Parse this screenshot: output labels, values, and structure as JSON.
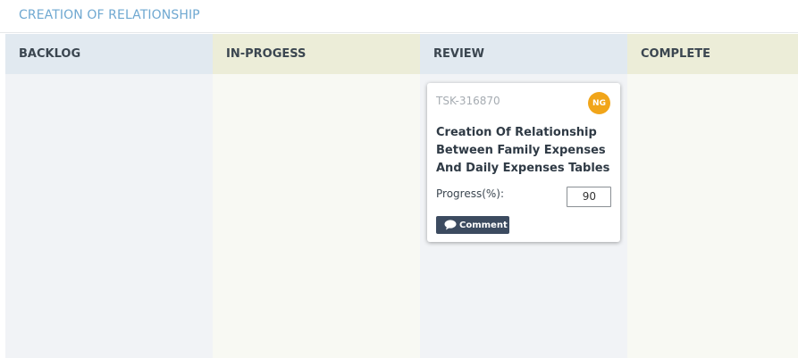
{
  "header": {
    "title": "CREATION OF RELATIONSHIP"
  },
  "columns": [
    {
      "label": "BACKLOG"
    },
    {
      "label": "IN-PROGESS"
    },
    {
      "label": "REVIEW"
    },
    {
      "label": "COMPLETE"
    }
  ],
  "card": {
    "task_id": "TSK-316870",
    "assignee_initials": "NG",
    "title": "Creation Of Relationship Between Family Expenses And Daily Expenses Tables",
    "progress_label": "Progress(%):",
    "progress_value": "90",
    "comment_label": "Comment"
  },
  "colors": {
    "header_title": "#6fa8d1",
    "avatar": "#f1a519",
    "comment_button": "#3c4b60"
  },
  "icons": {
    "comment": "speech-bubble-icon"
  }
}
